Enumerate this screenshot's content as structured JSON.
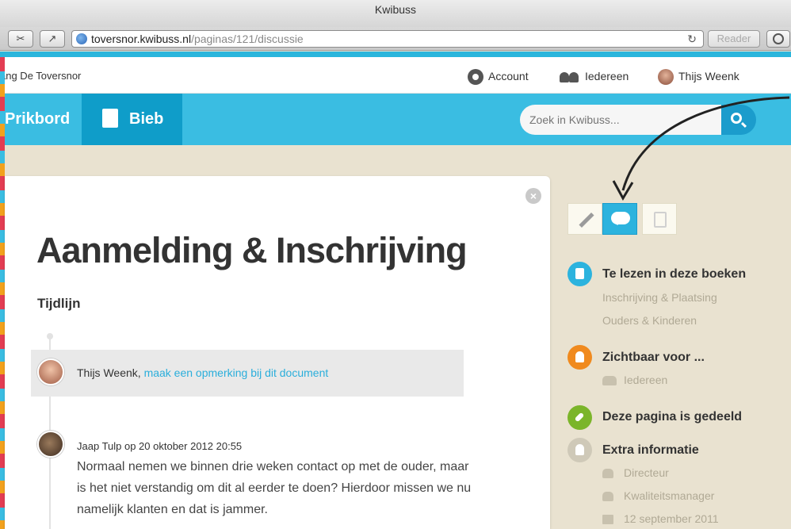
{
  "browser": {
    "title": "Kwibuss",
    "url_host": "toversnor.kwibuss.nl",
    "url_path": "/paginas/121/discussie",
    "reader_label": "Reader",
    "reload_icon": "reload-icon"
  },
  "topnav": {
    "school": "ang De Toversnor",
    "account": "Account",
    "everyone": "Iedereen",
    "user": "Thijs Weenk"
  },
  "mainnav": {
    "tabs": [
      {
        "label": "Prikbord",
        "active": false
      },
      {
        "label": "Bieb",
        "active": true
      }
    ],
    "search_placeholder": "Zoek in Kwibuss..."
  },
  "page": {
    "title": "Aanmelding & Inschrijving",
    "subtitle": "Tijdlijn",
    "comment_prompt": {
      "author": "Thijs Weenk,",
      "link": "maak een opmerking bij dit document"
    },
    "posts": [
      {
        "meta": "Jaap Tulp op 20 oktober 2012 20:55",
        "body": "Normaal nemen we binnen drie weken contact op met de ouder, maar is het niet verstandig om dit al eerder te doen? Hierdoor missen we nu namelijk klanten en dat is jammer."
      }
    ]
  },
  "sidebar": {
    "actions": [
      "pencil-icon",
      "comment-icon",
      "trash-icon"
    ],
    "sections": {
      "books_title": "Te lezen in deze boeken",
      "books": [
        "Inschrijving & Plaatsing",
        "Ouders & Kinderen"
      ],
      "visible_title": "Zichtbaar voor ...",
      "visible_item": "Iedereen",
      "shared_title": "Deze pagina is gedeeld",
      "extra_title": "Extra informatie",
      "extra_items": [
        "Directeur",
        "Kwaliteitsmanager",
        "12 september 2011"
      ]
    },
    "colors": {
      "accent": "#2cb3de",
      "orange": "#f08a1e",
      "green": "#7bb52a"
    }
  }
}
